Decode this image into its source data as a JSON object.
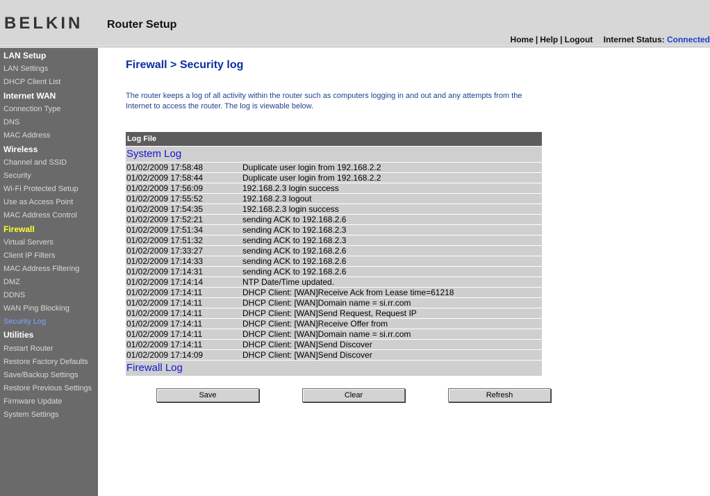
{
  "header": {
    "logo": "BELKIN",
    "title": "Router Setup",
    "nav": {
      "home": "Home",
      "help": "Help",
      "logout": "Logout"
    },
    "status_label": "Internet Status:",
    "status_value": "Connected"
  },
  "sidebar": {
    "sections": [
      {
        "title": "LAN Setup",
        "items": [
          "LAN Settings",
          "DHCP Client List"
        ]
      },
      {
        "title": "Internet WAN",
        "items": [
          "Connection Type",
          "DNS",
          "MAC Address"
        ]
      },
      {
        "title": "Wireless",
        "items": [
          "Channel and SSID",
          "Security",
          "Wi-Fi Protected Setup",
          "Use as Access Point",
          "MAC Address Control"
        ]
      },
      {
        "title": "Firewall",
        "items": [
          "Virtual Servers",
          "Client IP Filters",
          "MAC Address Filtering",
          "DMZ",
          "DDNS",
          "WAN Ping Blocking",
          "Security Log"
        ]
      },
      {
        "title": "Utilities",
        "items": [
          "Restart Router",
          "Restore Factory Defaults",
          "Save/Backup Settings",
          "Restore Previous Settings",
          "Firmware Update",
          "System Settings"
        ]
      }
    ]
  },
  "main": {
    "title": "Firewall > Security log",
    "intro": "The router keeps a log of all activity within the router such as computers logging in and out and any attempts from the Internet to access the router. The log is viewable below.",
    "log_header": "Log File",
    "system_log_title": "System Log",
    "firewall_log_title": "Firewall Log",
    "entries": [
      {
        "time": "01/02/2009 17:58:48",
        "message": "Duplicate user login from 192.168.2.2"
      },
      {
        "time": "01/02/2009 17:58:44",
        "message": "Duplicate user login from 192.168.2.2"
      },
      {
        "time": "01/02/2009 17:56:09",
        "message": "192.168.2.3 login success"
      },
      {
        "time": "01/02/2009 17:55:52",
        "message": "192.168.2.3 logout"
      },
      {
        "time": "01/02/2009 17:54:35",
        "message": "192.168.2.3 login success"
      },
      {
        "time": "01/02/2009 17:52:21",
        "message": "sending ACK to 192.168.2.6"
      },
      {
        "time": "01/02/2009 17:51:34",
        "message": "sending ACK to 192.168.2.3"
      },
      {
        "time": "01/02/2009 17:51:32",
        "message": "sending ACK to 192.168.2.3"
      },
      {
        "time": "01/02/2009 17:33:27",
        "message": "sending ACK to 192.168.2.6"
      },
      {
        "time": "01/02/2009 17:14:33",
        "message": "sending ACK to 192.168.2.6"
      },
      {
        "time": "01/02/2009 17:14:31",
        "message": "sending ACK to 192.168.2.6"
      },
      {
        "time": "01/02/2009 17:14:14",
        "message": "NTP Date/Time updated."
      },
      {
        "time": "01/02/2009 17:14:11",
        "message": "DHCP Client: [WAN]Receive Ack from          Lease time=61218"
      },
      {
        "time": "01/02/2009 17:14:11",
        "message": "DHCP Client: [WAN]Domain name = si.rr.com"
      },
      {
        "time": "01/02/2009 17:14:11",
        "message": "DHCP Client: [WAN]Send Request, Request IP"
      },
      {
        "time": "01/02/2009 17:14:11",
        "message": "DHCP Client: [WAN]Receive Offer from"
      },
      {
        "time": "01/02/2009 17:14:11",
        "message": "DHCP Client: [WAN]Domain name = si.rr.com"
      },
      {
        "time": "01/02/2009 17:14:11",
        "message": "DHCP Client: [WAN]Send Discover"
      },
      {
        "time": "01/02/2009 17:14:09",
        "message": "DHCP Client: [WAN]Send Discover"
      }
    ],
    "buttons": {
      "save": "Save",
      "clear": "Clear",
      "refresh": "Refresh"
    }
  }
}
